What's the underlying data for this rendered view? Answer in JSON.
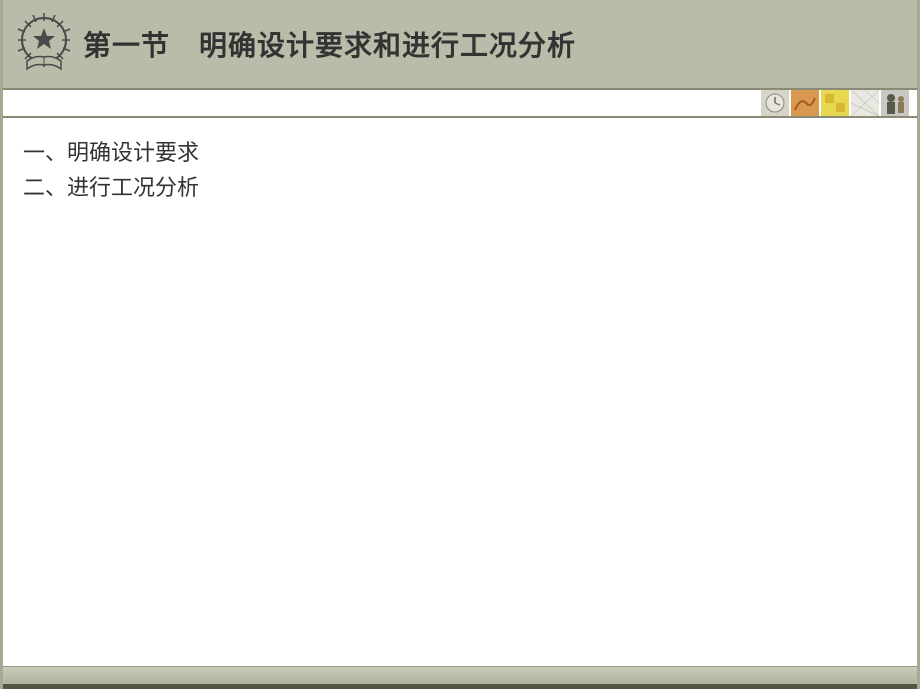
{
  "header": {
    "title": "第一节　明确设计要求和进行工况分析"
  },
  "content": {
    "items": [
      "一、明确设计要求",
      "二、进行工况分析"
    ]
  },
  "icons": {
    "logo": "gear-star-book-emblem",
    "strip": [
      "clock-icon",
      "abstract-icon",
      "puzzle-icon",
      "grid-icon",
      "people-icon"
    ]
  }
}
